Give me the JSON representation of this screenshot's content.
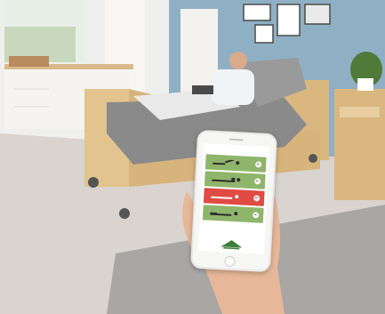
{
  "photo": {
    "description_icons": {
      "logo": "triangle-logo-icon",
      "control": "bed-position-icon",
      "arrow": "arrow-right-icon"
    },
    "colors": {
      "wall": "#8fb0c4",
      "floor": "#d8d3cd",
      "bed_wood": "#d9b77f",
      "blanket": "#8c8c8c",
      "row_green": "#8fb56a",
      "row_red": "#e04b43"
    }
  },
  "phone_app": {
    "title": "",
    "rows": [
      {
        "state": "normal"
      },
      {
        "state": "normal"
      },
      {
        "state": "active"
      },
      {
        "state": "normal"
      }
    ]
  }
}
